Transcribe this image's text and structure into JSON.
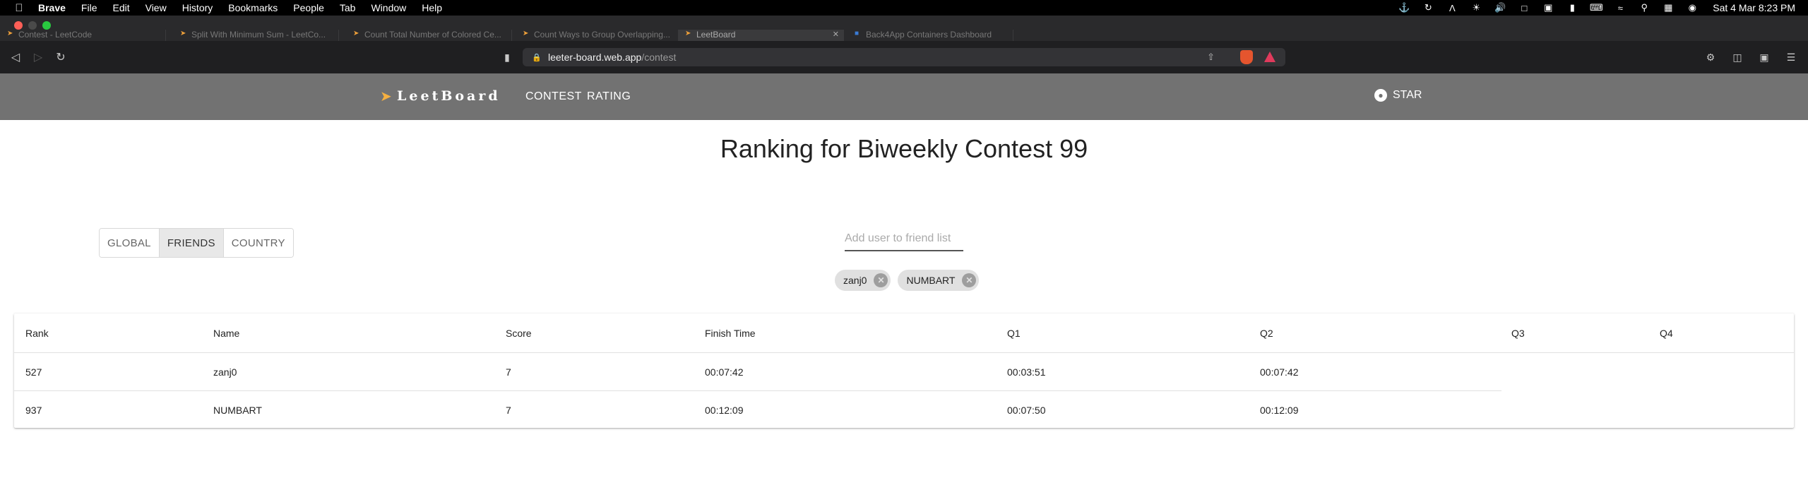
{
  "menubar": {
    "app_name": "Brave",
    "items": [
      "File",
      "Edit",
      "View",
      "History",
      "Bookmarks",
      "People",
      "Tab",
      "Window",
      "Help"
    ],
    "clock": "Sat 4 Mar  8:23 PM"
  },
  "tabs": [
    {
      "title": "Contest - LeetCode"
    },
    {
      "title": "Split With Minimum Sum - LeetCo..."
    },
    {
      "title": "Count Total Number of Colored Ce..."
    },
    {
      "title": "Count Ways to Group Overlapping..."
    },
    {
      "title": "LeetBoard"
    },
    {
      "title": "Back4App Containers Dashboard"
    }
  ],
  "address": {
    "host": "leeter-board.web.app",
    "path": "/contest"
  },
  "site": {
    "logo_text": "LeetBoard",
    "nav": {
      "contest": "CONTEST",
      "rating": "RATING"
    },
    "star_label": "STAR"
  },
  "page": {
    "title": "Ranking for Biweekly Contest 99",
    "toggles": {
      "global": "GLOBAL",
      "friends": "FRIENDS",
      "country": "COUNTRY"
    },
    "friend_input_placeholder": "Add user to friend list",
    "chips": [
      "zanj0",
      "NUMBART"
    ]
  },
  "table": {
    "headers": [
      "Rank",
      "Name",
      "Score",
      "Finish Time",
      "Q1",
      "Q2",
      "Q3",
      "Q4"
    ],
    "rows": [
      [
        "527",
        "zanj0",
        "7",
        "00:07:42",
        "00:03:51",
        "00:07:42",
        "",
        ""
      ],
      [
        "937",
        "NUMBART",
        "7",
        "00:12:09",
        "00:07:50",
        "00:12:09",
        "",
        ""
      ]
    ]
  },
  "colors": {
    "header_bg": "#727272",
    "selected_toggle_bg": "#e8e8e8",
    "chip_bg": "#e0e0e0"
  }
}
